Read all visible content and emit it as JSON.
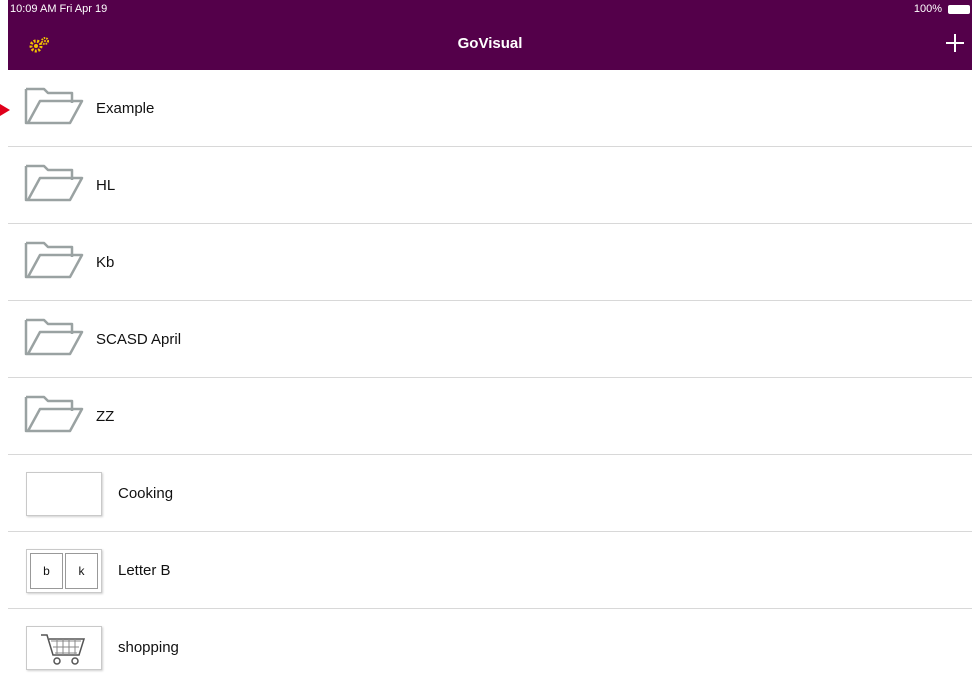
{
  "status_bar": {
    "time": "10:09 AM  Fri Apr 19",
    "battery": "100%"
  },
  "nav": {
    "title": "GoVisual",
    "settings_icon": "gears-icon",
    "add_icon": "plus-icon"
  },
  "colors": {
    "header_bg": "#54004a",
    "settings_icon": "#f2c200",
    "folder_outline": "#9aa2a2",
    "pointer": "#e0001b"
  },
  "items": [
    {
      "label": "Example",
      "kind": "folder"
    },
    {
      "label": "HL",
      "kind": "folder"
    },
    {
      "label": "Kb",
      "kind": "folder"
    },
    {
      "label": "SCASD April",
      "kind": "folder"
    },
    {
      "label": "ZZ",
      "kind": "folder"
    },
    {
      "label": "Cooking",
      "kind": "board"
    },
    {
      "label": "Letter B",
      "kind": "board",
      "tiles": [
        "b",
        "k"
      ]
    },
    {
      "label": "shopping",
      "kind": "board",
      "icon": "shopping-cart-icon"
    }
  ]
}
